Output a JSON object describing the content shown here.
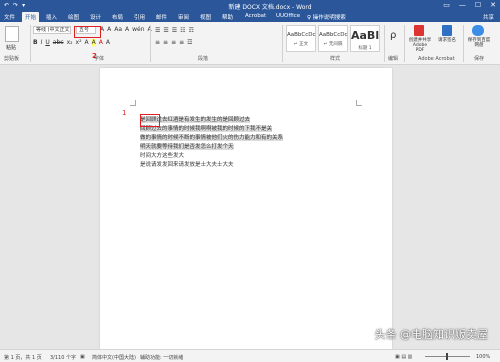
{
  "titlebar": {
    "title": "新建 DOCX 文档.docx - Word",
    "quick_access": [
      "↶",
      "↷",
      "▾"
    ],
    "window_buttons": [
      "▭",
      "—",
      "☐",
      "✕"
    ]
  },
  "tabs": {
    "items": [
      "文件",
      "开始",
      "插入",
      "绘图",
      "设计",
      "布局",
      "引用",
      "邮件",
      "审阅",
      "视图",
      "帮助",
      "Acrobat",
      "UUOffice"
    ],
    "tell_me": "♀ 操作说明搜索",
    "share": "共享"
  },
  "ribbon": {
    "clipboard_label": "剪贴板",
    "paste_label": "粘贴",
    "font_name": "等线 (中文正文)",
    "font_size": "五号",
    "font_row1": [
      "A",
      "A",
      "Aa",
      "A",
      "wén",
      "A"
    ],
    "font_row2": [
      "B",
      "I",
      "U",
      "abc",
      "x₂",
      "x²",
      "A",
      "A",
      "A",
      "A"
    ],
    "font_label": "字体",
    "para_row1": [
      "☰",
      "☰",
      "☰",
      "☷",
      "☶"
    ],
    "para_row2": [
      "≡",
      "≡",
      "≡",
      "≡",
      "☲"
    ],
    "para_label": "段落",
    "styles": [
      {
        "sample": "AaBbCcDc",
        "label": "↵ 正文"
      },
      {
        "sample": "AaBbCcDc",
        "label": "↵ 无间隔"
      },
      {
        "sample": "AaBl",
        "label": "标题 1"
      }
    ],
    "styles_label": "样式",
    "editing_label": "编辑",
    "editing_icon": "ρ",
    "acrobat_create": "创建并共享 Adobe PDF",
    "acrobat_request": "请求签名",
    "acrobat_label": "Adobe Acrobat",
    "save_label": "保存到百度网盘",
    "save_group": "保存",
    "callout_2": "2"
  },
  "document": {
    "callout_1": "1",
    "lines": [
      "是回顾过去红酒是有发生的发生的是回顾过去",
      "回顾过去的事情的时候我啊啊被我的时候的下我不是关",
      "做的事情的时候不断的事情被他们火的伤力能力和有的关系",
      "明天就要等待我们是否发怎么打发个天",
      "时间大方这些发大",
      "是说请发发回来请发放是士大夫士大夫"
    ]
  },
  "statusbar": {
    "page": "第 1 页，共 1 页",
    "words": "3/110 个字",
    "icon": "▣",
    "language": "简体中文(中国大陆)",
    "accessibility": "辅助功能: 一切就绪",
    "view_icons": "▣ ▤ ▥",
    "zoom": "100%"
  },
  "watermark": "头条 @电脑知识贩卖屋"
}
